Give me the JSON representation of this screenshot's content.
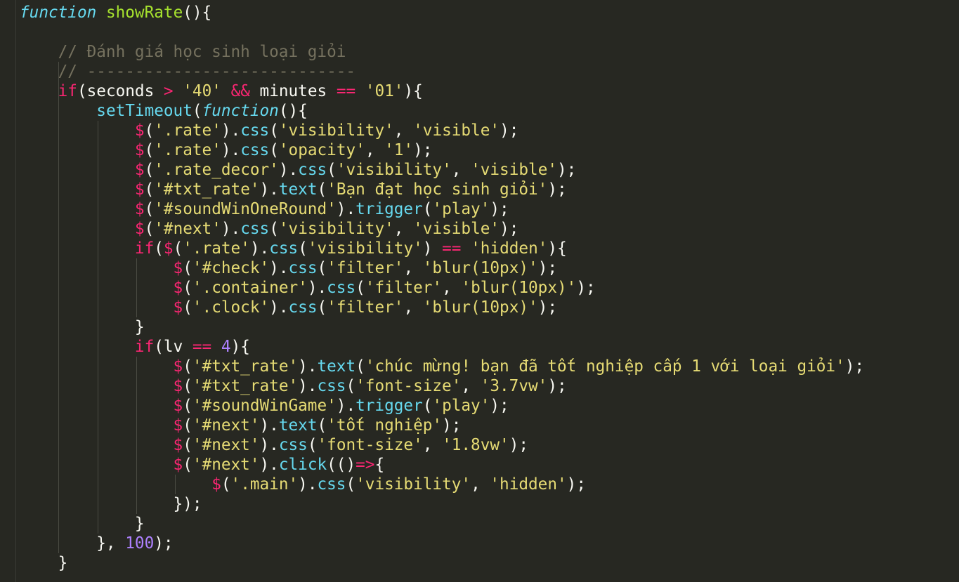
{
  "colors": {
    "background": "#272822",
    "text": "#f8f8f2",
    "keyword": "#f92672",
    "string": "#e6db74",
    "function_call": "#66d9ef",
    "function_name": "#a6e22e",
    "number": "#ae81ff",
    "comment": "#75715e"
  },
  "code": {
    "lines": [
      [
        [
          "function",
          "fnit"
        ],
        [
          " ",
          ""
        ],
        [
          "showRate",
          "nm"
        ],
        [
          "(){",
          ""
        ]
      ],
      [],
      [
        [
          "    ",
          ""
        ],
        [
          "// Đánh giá học sinh loại giỏi",
          "cm"
        ]
      ],
      [
        [
          "    ",
          ""
        ],
        [
          "// ----------------------------",
          "cm"
        ]
      ],
      [
        [
          "    ",
          ""
        ],
        [
          "if",
          "kw"
        ],
        [
          "(seconds ",
          ""
        ],
        [
          ">",
          "kw"
        ],
        [
          " ",
          ""
        ],
        [
          "'40'",
          "str"
        ],
        [
          " ",
          ""
        ],
        [
          "&&",
          "kw"
        ],
        [
          " minutes ",
          ""
        ],
        [
          "==",
          "kw"
        ],
        [
          " ",
          ""
        ],
        [
          "'01'",
          "str"
        ],
        [
          "){",
          ""
        ]
      ],
      [
        [
          "        ",
          ""
        ],
        [
          "setTimeout",
          "fn"
        ],
        [
          "(",
          ""
        ],
        [
          "function",
          "fnit"
        ],
        [
          "(){",
          ""
        ]
      ],
      [
        [
          "            ",
          ""
        ],
        [
          "$",
          "kw"
        ],
        [
          "(",
          ""
        ],
        [
          "'.rate'",
          "str"
        ],
        [
          ").",
          ""
        ],
        [
          "css",
          "fn"
        ],
        [
          "(",
          ""
        ],
        [
          "'visibility'",
          "str"
        ],
        [
          ", ",
          ""
        ],
        [
          "'visible'",
          "str"
        ],
        [
          ");",
          ""
        ]
      ],
      [
        [
          "            ",
          ""
        ],
        [
          "$",
          "kw"
        ],
        [
          "(",
          ""
        ],
        [
          "'.rate'",
          "str"
        ],
        [
          ").",
          ""
        ],
        [
          "css",
          "fn"
        ],
        [
          "(",
          ""
        ],
        [
          "'opacity'",
          "str"
        ],
        [
          ", ",
          ""
        ],
        [
          "'1'",
          "str"
        ],
        [
          ");",
          ""
        ]
      ],
      [
        [
          "            ",
          ""
        ],
        [
          "$",
          "kw"
        ],
        [
          "(",
          ""
        ],
        [
          "'.rate_decor'",
          "str"
        ],
        [
          ").",
          ""
        ],
        [
          "css",
          "fn"
        ],
        [
          "(",
          ""
        ],
        [
          "'visibility'",
          "str"
        ],
        [
          ", ",
          ""
        ],
        [
          "'visible'",
          "str"
        ],
        [
          ");",
          ""
        ]
      ],
      [
        [
          "            ",
          ""
        ],
        [
          "$",
          "kw"
        ],
        [
          "(",
          ""
        ],
        [
          "'#txt_rate'",
          "str"
        ],
        [
          ").",
          ""
        ],
        [
          "text",
          "fn"
        ],
        [
          "(",
          ""
        ],
        [
          "'Bạn đạt học sinh giỏi'",
          "str"
        ],
        [
          ");",
          ""
        ]
      ],
      [
        [
          "            ",
          ""
        ],
        [
          "$",
          "kw"
        ],
        [
          "(",
          ""
        ],
        [
          "'#soundWinOneRound'",
          "str"
        ],
        [
          ").",
          ""
        ],
        [
          "trigger",
          "fn"
        ],
        [
          "(",
          ""
        ],
        [
          "'play'",
          "str"
        ],
        [
          ");",
          ""
        ]
      ],
      [
        [
          "            ",
          ""
        ],
        [
          "$",
          "kw"
        ],
        [
          "(",
          ""
        ],
        [
          "'#next'",
          "str"
        ],
        [
          ").",
          ""
        ],
        [
          "css",
          "fn"
        ],
        [
          "(",
          ""
        ],
        [
          "'visibility'",
          "str"
        ],
        [
          ", ",
          ""
        ],
        [
          "'visible'",
          "str"
        ],
        [
          ");",
          ""
        ]
      ],
      [
        [
          "            ",
          ""
        ],
        [
          "if",
          "kw"
        ],
        [
          "(",
          ""
        ],
        [
          "$",
          "kw"
        ],
        [
          "(",
          ""
        ],
        [
          "'.rate'",
          "str"
        ],
        [
          ").",
          ""
        ],
        [
          "css",
          "fn"
        ],
        [
          "(",
          ""
        ],
        [
          "'visibility'",
          "str"
        ],
        [
          ") ",
          ""
        ],
        [
          "==",
          "kw"
        ],
        [
          " ",
          ""
        ],
        [
          "'hidden'",
          "str"
        ],
        [
          "){",
          ""
        ]
      ],
      [
        [
          "                ",
          ""
        ],
        [
          "$",
          "kw"
        ],
        [
          "(",
          ""
        ],
        [
          "'#check'",
          "str"
        ],
        [
          ").",
          ""
        ],
        [
          "css",
          "fn"
        ],
        [
          "(",
          ""
        ],
        [
          "'filter'",
          "str"
        ],
        [
          ", ",
          ""
        ],
        [
          "'blur(10px)'",
          "str"
        ],
        [
          ");",
          ""
        ]
      ],
      [
        [
          "                ",
          ""
        ],
        [
          "$",
          "kw"
        ],
        [
          "(",
          ""
        ],
        [
          "'.container'",
          "str"
        ],
        [
          ").",
          ""
        ],
        [
          "css",
          "fn"
        ],
        [
          "(",
          ""
        ],
        [
          "'filter'",
          "str"
        ],
        [
          ", ",
          ""
        ],
        [
          "'blur(10px)'",
          "str"
        ],
        [
          ");",
          ""
        ]
      ],
      [
        [
          "                ",
          ""
        ],
        [
          "$",
          "kw"
        ],
        [
          "(",
          ""
        ],
        [
          "'.clock'",
          "str"
        ],
        [
          ").",
          ""
        ],
        [
          "css",
          "fn"
        ],
        [
          "(",
          ""
        ],
        [
          "'filter'",
          "str"
        ],
        [
          ", ",
          ""
        ],
        [
          "'blur(10px)'",
          "str"
        ],
        [
          ");",
          ""
        ]
      ],
      [
        [
          "            }",
          ""
        ]
      ],
      [
        [
          "            ",
          ""
        ],
        [
          "if",
          "kw"
        ],
        [
          "(lv ",
          ""
        ],
        [
          "==",
          "kw"
        ],
        [
          " ",
          ""
        ],
        [
          "4",
          "num"
        ],
        [
          "){",
          ""
        ]
      ],
      [
        [
          "                ",
          ""
        ],
        [
          "$",
          "kw"
        ],
        [
          "(",
          ""
        ],
        [
          "'#txt_rate'",
          "str"
        ],
        [
          ").",
          ""
        ],
        [
          "text",
          "fn"
        ],
        [
          "(",
          ""
        ],
        [
          "'chúc mừng! bạn đã tốt nghiệp cấp 1 với loại giỏi'",
          "str"
        ],
        [
          ");",
          ""
        ]
      ],
      [
        [
          "                ",
          ""
        ],
        [
          "$",
          "kw"
        ],
        [
          "(",
          ""
        ],
        [
          "'#txt_rate'",
          "str"
        ],
        [
          ").",
          ""
        ],
        [
          "css",
          "fn"
        ],
        [
          "(",
          ""
        ],
        [
          "'font-size'",
          "str"
        ],
        [
          ", ",
          ""
        ],
        [
          "'3.7vw'",
          "str"
        ],
        [
          ");",
          ""
        ]
      ],
      [
        [
          "                ",
          ""
        ],
        [
          "$",
          "kw"
        ],
        [
          "(",
          ""
        ],
        [
          "'#soundWinGame'",
          "str"
        ],
        [
          ").",
          ""
        ],
        [
          "trigger",
          "fn"
        ],
        [
          "(",
          ""
        ],
        [
          "'play'",
          "str"
        ],
        [
          ");",
          ""
        ]
      ],
      [
        [
          "                ",
          ""
        ],
        [
          "$",
          "kw"
        ],
        [
          "(",
          ""
        ],
        [
          "'#next'",
          "str"
        ],
        [
          ").",
          ""
        ],
        [
          "text",
          "fn"
        ],
        [
          "(",
          ""
        ],
        [
          "'tốt nghiệp'",
          "str"
        ],
        [
          ");",
          ""
        ]
      ],
      [
        [
          "                ",
          ""
        ],
        [
          "$",
          "kw"
        ],
        [
          "(",
          ""
        ],
        [
          "'#next'",
          "str"
        ],
        [
          ").",
          ""
        ],
        [
          "css",
          "fn"
        ],
        [
          "(",
          ""
        ],
        [
          "'font-size'",
          "str"
        ],
        [
          ", ",
          ""
        ],
        [
          "'1.8vw'",
          "str"
        ],
        [
          ");",
          ""
        ]
      ],
      [
        [
          "                ",
          ""
        ],
        [
          "$",
          "kw"
        ],
        [
          "(",
          ""
        ],
        [
          "'#next'",
          "str"
        ],
        [
          ").",
          ""
        ],
        [
          "click",
          "fn"
        ],
        [
          "(()",
          ""
        ],
        [
          "=>",
          "kw"
        ],
        [
          "{",
          ""
        ]
      ],
      [
        [
          "                    ",
          ""
        ],
        [
          "$",
          "kw"
        ],
        [
          "(",
          ""
        ],
        [
          "'.main'",
          "str"
        ],
        [
          ").",
          ""
        ],
        [
          "css",
          "fn"
        ],
        [
          "(",
          ""
        ],
        [
          "'visibility'",
          "str"
        ],
        [
          ", ",
          ""
        ],
        [
          "'hidden'",
          "str"
        ],
        [
          ");",
          ""
        ]
      ],
      [
        [
          "                });",
          ""
        ]
      ],
      [
        [
          "            }",
          ""
        ]
      ],
      [
        [
          "        }, ",
          ""
        ],
        [
          "100",
          "num"
        ],
        [
          ");",
          ""
        ]
      ],
      [
        [
          "    }",
          ""
        ]
      ]
    ]
  }
}
